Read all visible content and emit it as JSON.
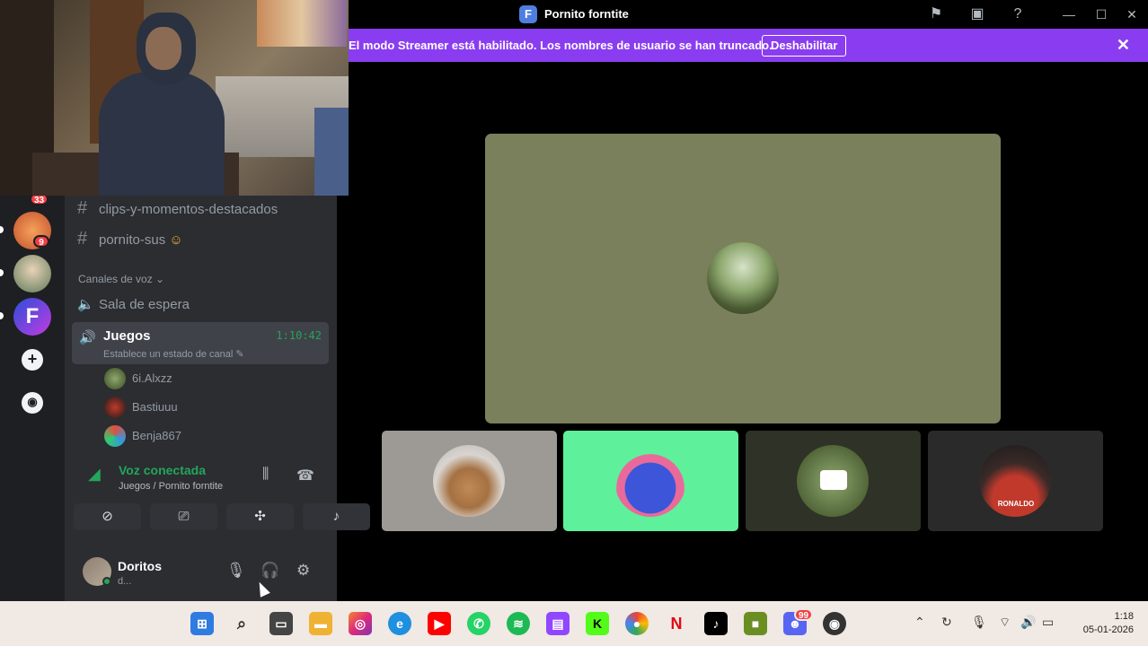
{
  "window": {
    "title": "Pornito forntite",
    "logo_letter": "F"
  },
  "banner": {
    "text": "El modo Streamer está habilitado. Los nombres de usuario se han truncado.",
    "button": "Deshabilitar"
  },
  "servers": {
    "badges": [
      "33",
      "9"
    ]
  },
  "channels": {
    "text_channels": [
      "clips-y-momentos-destacados",
      "pornito-sus"
    ],
    "voice_category": "Canales de voz",
    "waiting_room": "Sala de espera",
    "active_voice": {
      "name": "Juegos",
      "timer": "1:10:42",
      "status": "Establece un estado de canal"
    },
    "members": [
      "6i.Alxzz",
      "Bastiuuu",
      "Benja867"
    ]
  },
  "voice_panel": {
    "title": "Voz conectada",
    "subtitle": "Juegos / Pornito forntite"
  },
  "user": {
    "name": "Doritos",
    "status": "d..."
  },
  "tiles": {
    "shirt_text": "RONALDO"
  },
  "taskbar": {
    "time": "1:18",
    "date": "05-01-2026",
    "discord_badge": "99"
  },
  "colors": {
    "accent_purple": "#8a3df0",
    "voice_green": "#23a55a",
    "main_tile": "#7b805c",
    "speaking_tile": "#5ef09a"
  }
}
